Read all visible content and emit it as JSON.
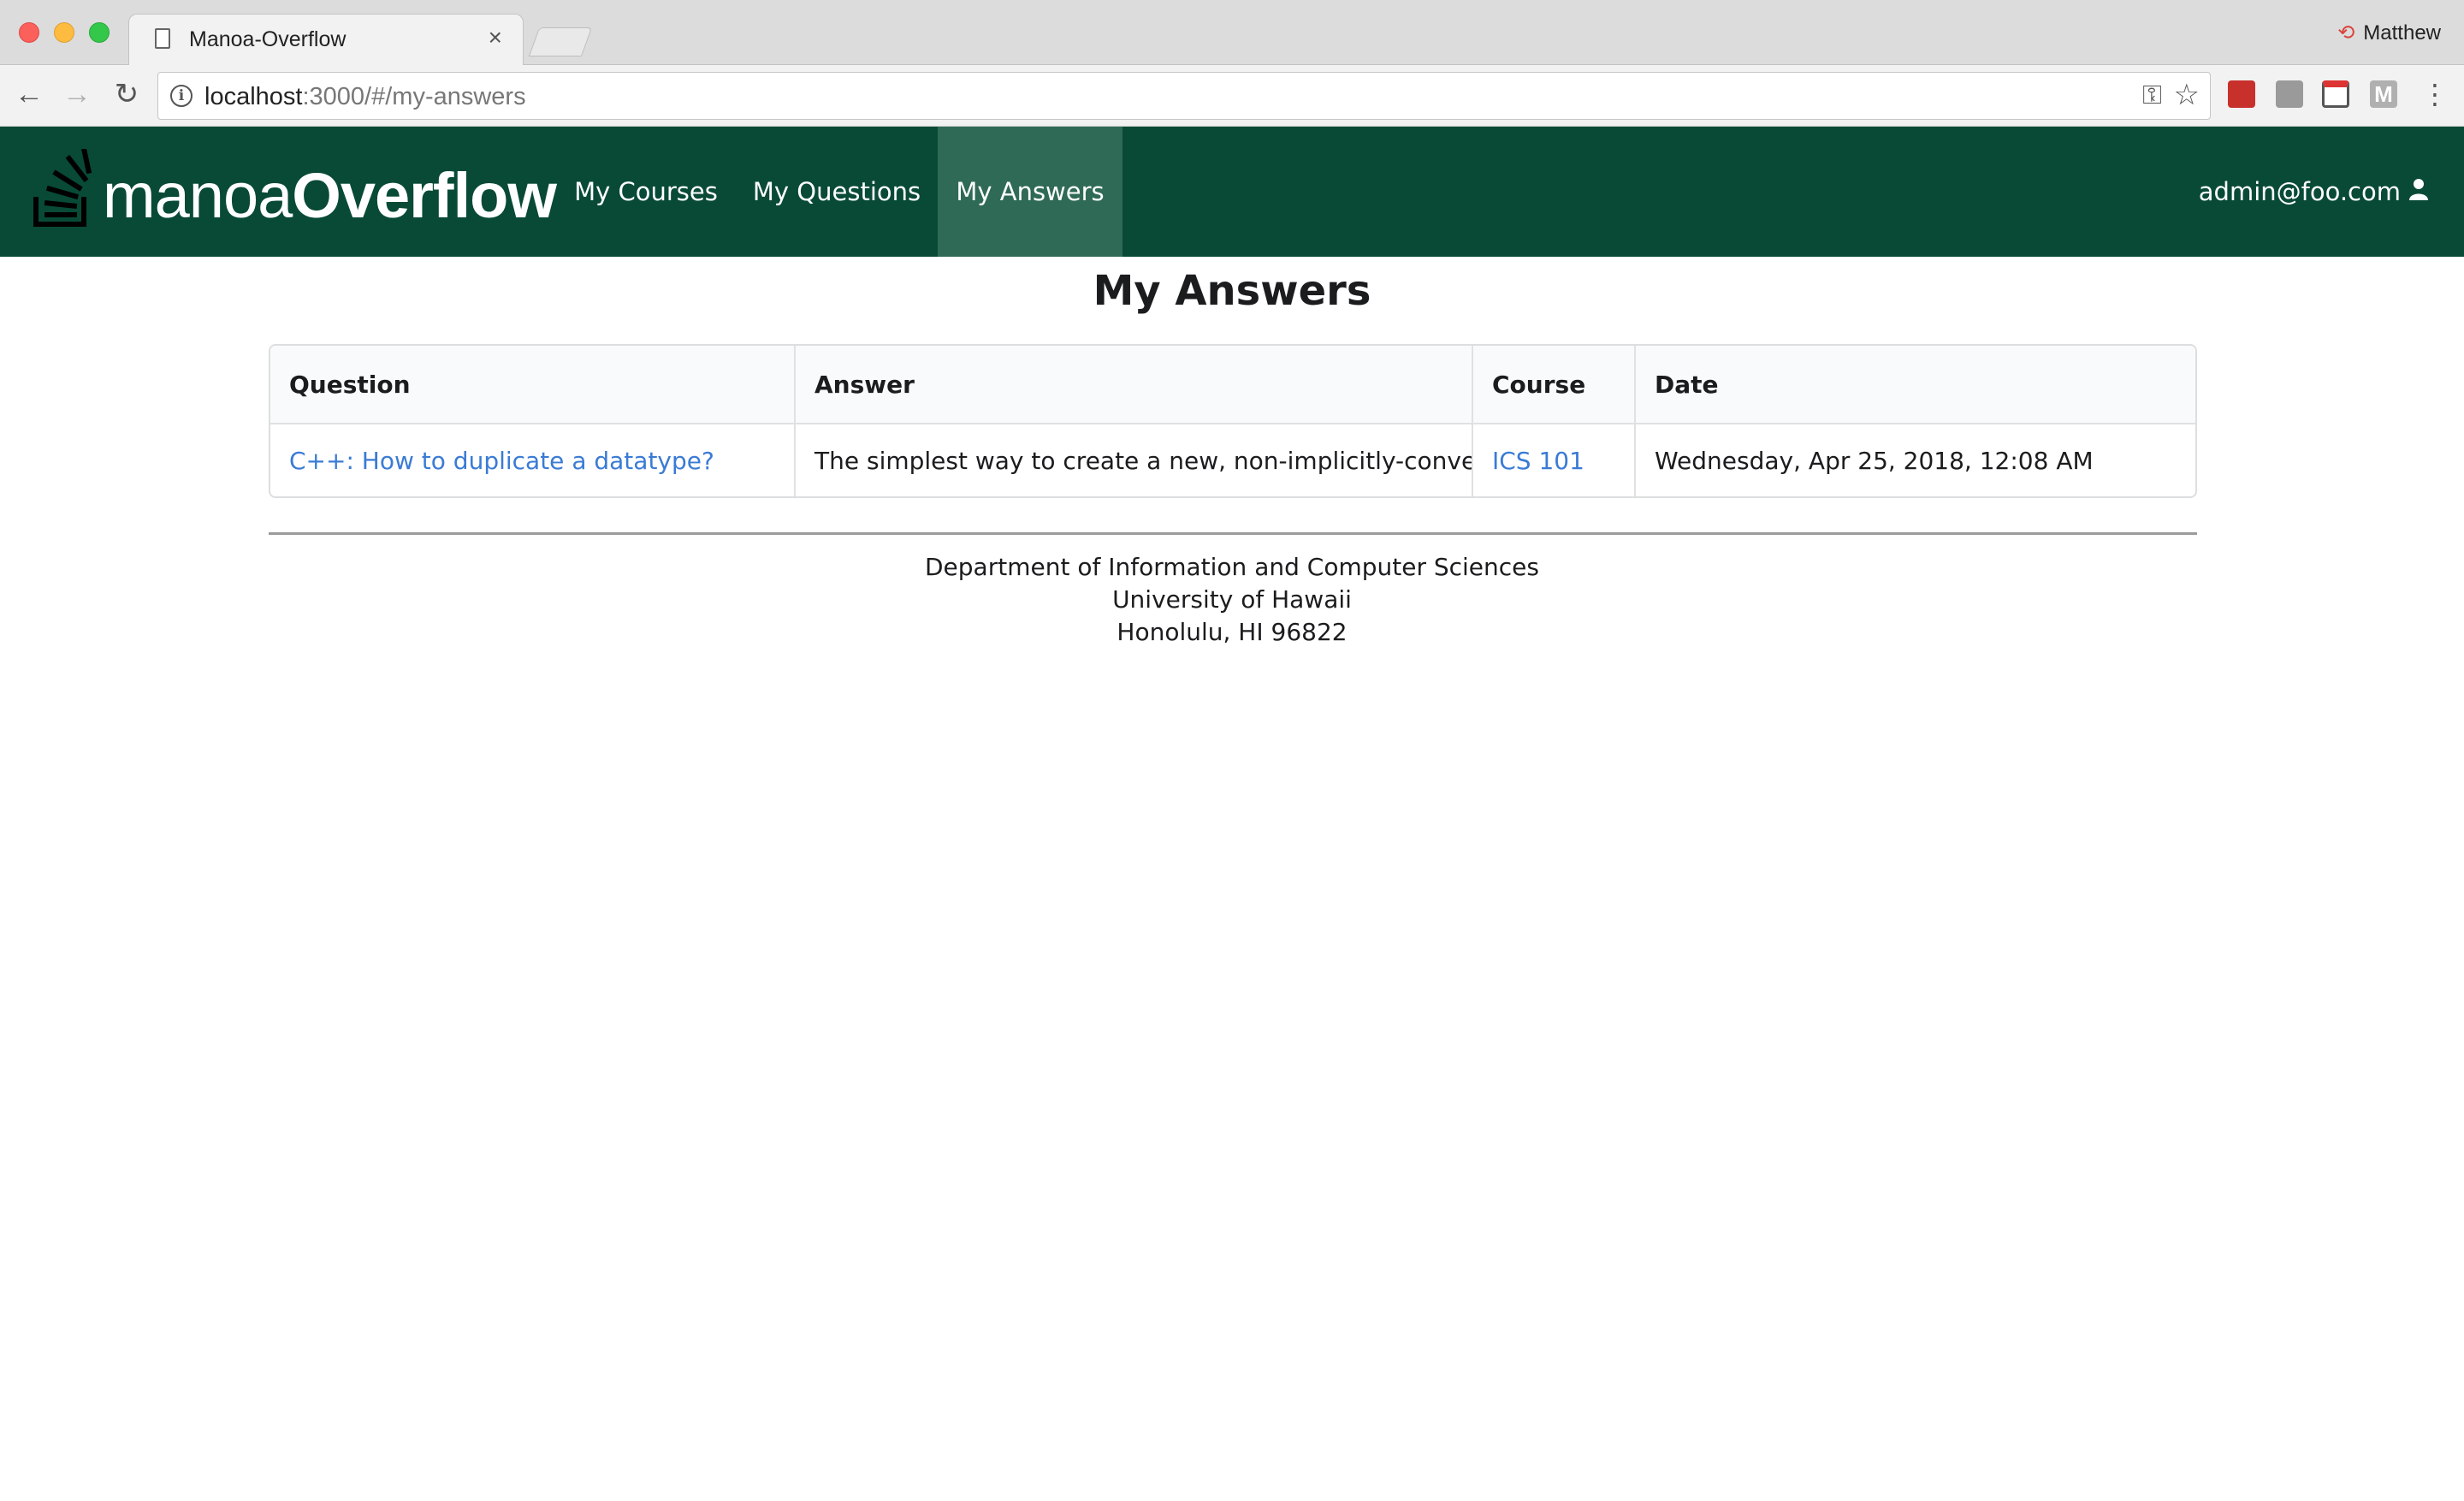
{
  "browser": {
    "tab_title": "Manoa-Overflow",
    "tab_close": "×",
    "profile_name": "Matthew",
    "url_host": "localhost",
    "url_rest": ":3000/#/my-answers"
  },
  "navbar": {
    "brand_light": "manoa",
    "brand_bold": "Overflow",
    "items": [
      {
        "label": "My Courses"
      },
      {
        "label": "My Questions"
      },
      {
        "label": "My Answers",
        "active": true
      }
    ],
    "user": "admin@foo.com"
  },
  "page": {
    "title": "My Answers"
  },
  "table": {
    "headers": [
      "Question",
      "Answer",
      "Course",
      "Date"
    ],
    "rows": [
      {
        "question": "C++: How to duplicate a datatype?",
        "answer": "The simplest way to create a new, non-implicitly-convertibl...",
        "course": "ICS 101",
        "date": "Wednesday, Apr 25, 2018, 12:08 AM"
      }
    ]
  },
  "footer": {
    "line1": "Department of Information and Computer Sciences",
    "line2": "University of Hawaii",
    "line3": "Honolulu, HI 96822"
  },
  "colors": {
    "navbar": "#084a36",
    "navbar_active": "#2f6a56",
    "link": "#3a7bd5"
  },
  "icons": {
    "back": "arrow-left-icon",
    "forward": "arrow-right-icon",
    "reload": "reload-icon",
    "info": "info-icon",
    "key": "key-icon",
    "star": "star-icon",
    "user": "user-icon",
    "logo": "stack-logo-icon"
  }
}
